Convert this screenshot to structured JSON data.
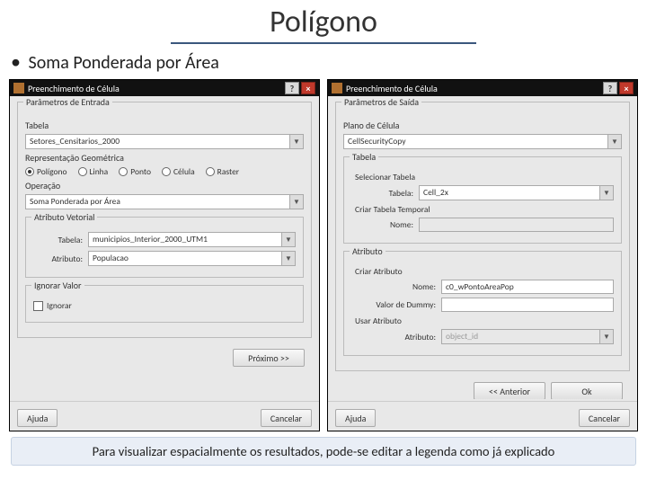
{
  "title": "Polígono",
  "subtitle": "Soma Ponderada por Área",
  "footer": "Para visualizar espacialmente os resultados, pode-se editar a legenda como já explicado",
  "left": {
    "window_title": "Preenchimento de Célula",
    "g_in": "Parâmetros de Entrada",
    "tabela_label": "Tabela",
    "tabela_value": "Setores_Censitarios_2000",
    "rep_label": "Representação Geométrica",
    "rep_options": [
      "Polígono",
      "Linha",
      "Ponto",
      "Célula",
      "Raster"
    ],
    "op_label": "Operação",
    "op_value": "Soma Ponderada por Área",
    "attr_group": "Atributo Vetorial",
    "tabela2_label": "Tabela:",
    "tabela2_value": "municipios_Interior_2000_UTM1",
    "atributo_label": "Atributo:",
    "atributo_value": "Populacao",
    "ignore_group": "Ignorar Valor",
    "ignore_cb": "Ignorar",
    "next_btn": "Próximo >>",
    "help_btn": "Ajuda",
    "cancel_btn": "Cancelar"
  },
  "right": {
    "window_title": "Preenchimento de Célula",
    "g_out": "Parâmetros de Saída",
    "plano_label": "Plano de Célula",
    "plano_value": "CellSecurityCopy",
    "tabela_group": "Tabela",
    "r_select_table": "Selecionar Tabela",
    "table_label": "Tabela:",
    "table_value": "Cell_2x",
    "r_create_temp": "Criar Tabela Temporal",
    "nome_label": "Nome:",
    "attr_group": "Atributo",
    "r_create_attr": "Criar Atributo",
    "nome_val": "c0_wPontoAreaPop",
    "dummy_label": "Valor de Dummy:",
    "r_use_attr": "Usar Atributo",
    "atributo_label": "Atributo:",
    "atributo_value": "object_id",
    "prev_btn": "<< Anterior",
    "ok_btn": "Ok",
    "help_btn": "Ajuda",
    "cancel_btn": "Cancelar"
  }
}
